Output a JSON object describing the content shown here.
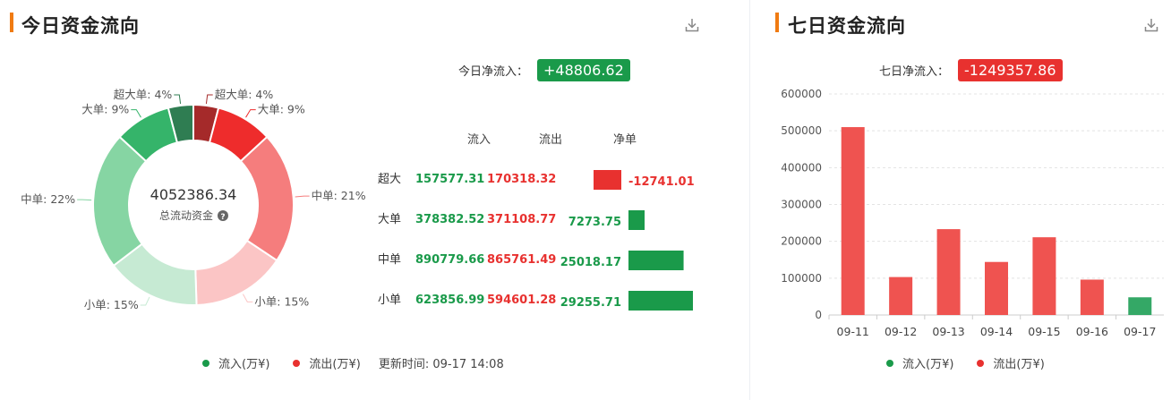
{
  "left": {
    "title": "今日资金流向",
    "net_label": "今日净流入：",
    "net_value": "+48806.62",
    "center_value": "4052386.34",
    "center_label": "总流动资金",
    "legend": {
      "inflow": "流入(万¥)",
      "outflow": "流出(万¥)",
      "update": "更新时间: 09-17 14:08"
    }
  },
  "right": {
    "title": "七日资金流向",
    "net_label": "七日净流入：",
    "net_value": "-1249357.86",
    "legend": {
      "inflow": "流入(万¥)",
      "outflow": "流出(万¥)"
    }
  },
  "colors": {
    "green": "#1a9a4a",
    "red": "#e8312f",
    "bar_red": "#ef5350",
    "bar_green": "#34a866",
    "accent": "#f07b12"
  },
  "chart_data": [
    {
      "type": "pie",
      "slices": [
        {
          "label": "超大单: 4%",
          "value": 4,
          "color": "#a52a2a"
        },
        {
          "label": "大单: 9%",
          "value": 9,
          "color": "#ee2c2c"
        },
        {
          "label": "中单: 21%",
          "value": 21,
          "color": "#f57d7d"
        },
        {
          "label": "小单: 15%",
          "value": 15,
          "color": "#fbc5c5"
        },
        {
          "label": "小单: 15%",
          "value": 15,
          "color": "#c6ead3"
        },
        {
          "label": "中单: 22%",
          "value": 22,
          "color": "#86d5a3"
        },
        {
          "label": "大单: 9%",
          "value": 9,
          "color": "#35b46a"
        },
        {
          "label": "超大单: 4%",
          "value": 4,
          "color": "#2f7d52"
        }
      ]
    },
    {
      "type": "table",
      "columns": [
        "流入",
        "流出",
        "净单"
      ],
      "rows": [
        {
          "label": "超大",
          "inflow": "157577.31",
          "outflow": "170318.32",
          "net_text": "-12741.01",
          "net": -12741.01
        },
        {
          "label": "大单",
          "inflow": "378382.52",
          "outflow": "371108.77",
          "net_text": "7273.75",
          "net": 7273.75
        },
        {
          "label": "中单",
          "inflow": "890779.66",
          "outflow": "865761.49",
          "net_text": "25018.17",
          "net": 25018.17
        },
        {
          "label": "小单",
          "inflow": "623856.99",
          "outflow": "594601.28",
          "net_text": "29255.71",
          "net": 29255.71
        }
      ]
    },
    {
      "type": "bar",
      "categories": [
        "09-11",
        "09-12",
        "09-13",
        "09-14",
        "09-15",
        "09-16",
        "09-17"
      ],
      "values": [
        510000,
        103000,
        233000,
        144000,
        211000,
        96000,
        48000
      ],
      "signs": [
        "out",
        "out",
        "out",
        "out",
        "out",
        "out",
        "in"
      ],
      "ylim": [
        0,
        600000
      ],
      "yticks": [
        "0",
        "100000",
        "200000",
        "300000",
        "400000",
        "500000",
        "600000"
      ],
      "grid": true
    }
  ]
}
